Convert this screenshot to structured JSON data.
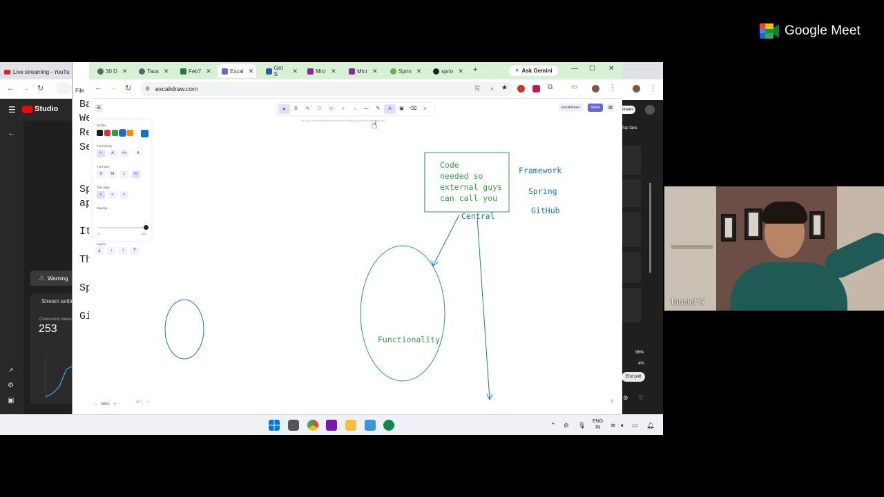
{
  "meet": {
    "brand": "Google Meet",
    "participant_name": "Tausief S"
  },
  "youtube": {
    "tab_label": "Live streaming - YouTu",
    "studio_label": "Studio",
    "warning_label": "Warning",
    "stream_settings_label": "Stream settin",
    "concurrent_label": "Concurrent viewers",
    "viewers": "253",
    "stream_button": "Stream",
    "top_fans": "Top fans",
    "end_poll": "End poll",
    "poll_pct_1": "96%",
    "poll_pct_2": "4%",
    "file_menu": "File"
  },
  "browser": {
    "tabs": [
      {
        "label": "30 D",
        "color": "#5f6368"
      },
      {
        "label": "Taus",
        "color": "#5f6368"
      },
      {
        "label": "Feb7",
        "color": "#188038"
      },
      {
        "label": "Excal",
        "color": "#6965db"
      },
      {
        "label": "Get S",
        "color": "#1565c0"
      },
      {
        "label": "Micr",
        "color": "#8e24aa"
      },
      {
        "label": "Micr",
        "color": "#8e24aa"
      },
      {
        "label": "Sprin",
        "color": "#6db33f"
      },
      {
        "label": "sprin",
        "color": "#222222"
      }
    ],
    "gemini_label": "Ask Gemini",
    "url": "excalidraw.com"
  },
  "doc_sliver_lines": [
    "Ba",
    "We",
    "Re",
    "Se",
    "Sp",
    "ap",
    "It",
    "Th",
    "Sp",
    "Gi"
  ],
  "excalidraw": {
    "tools": [
      "lock",
      "hand",
      "select",
      "rect",
      "diamond",
      "ellipse",
      "arrow",
      "line",
      "draw",
      "text",
      "image",
      "eraser",
      "more"
    ],
    "hint": "Tip: you can also add text by Double-clicking or use the selection tool",
    "excalidraw_plus": "Excalidraw+",
    "share": "Share",
    "props": {
      "stroke": "Stroke",
      "font_family": "Font family",
      "font_size": "Font size",
      "text_align": "Text align",
      "opacity": "Opacity",
      "layers": "Layers",
      "sizes": [
        "S",
        "M",
        "L",
        "XL"
      ],
      "opacity_min": "0",
      "opacity_max": "100",
      "opacity_value": 1.0
    },
    "stroke_colors": [
      "#1e1e1e",
      "#e03131",
      "#2f9e44",
      "#1971c2",
      "#f08c00"
    ],
    "current_color": "#1971c2",
    "zoom": "86%",
    "texts": {
      "code_box": [
        "Code",
        "needed so",
        "external guys",
        "can call you"
      ],
      "framework": "Framework",
      "spring": "Spring",
      "github": "GitHub",
      "central": "Central",
      "functionality": "Functionality"
    }
  },
  "taskbar": {
    "lang_1": "ENG",
    "lang_2": "IN"
  }
}
